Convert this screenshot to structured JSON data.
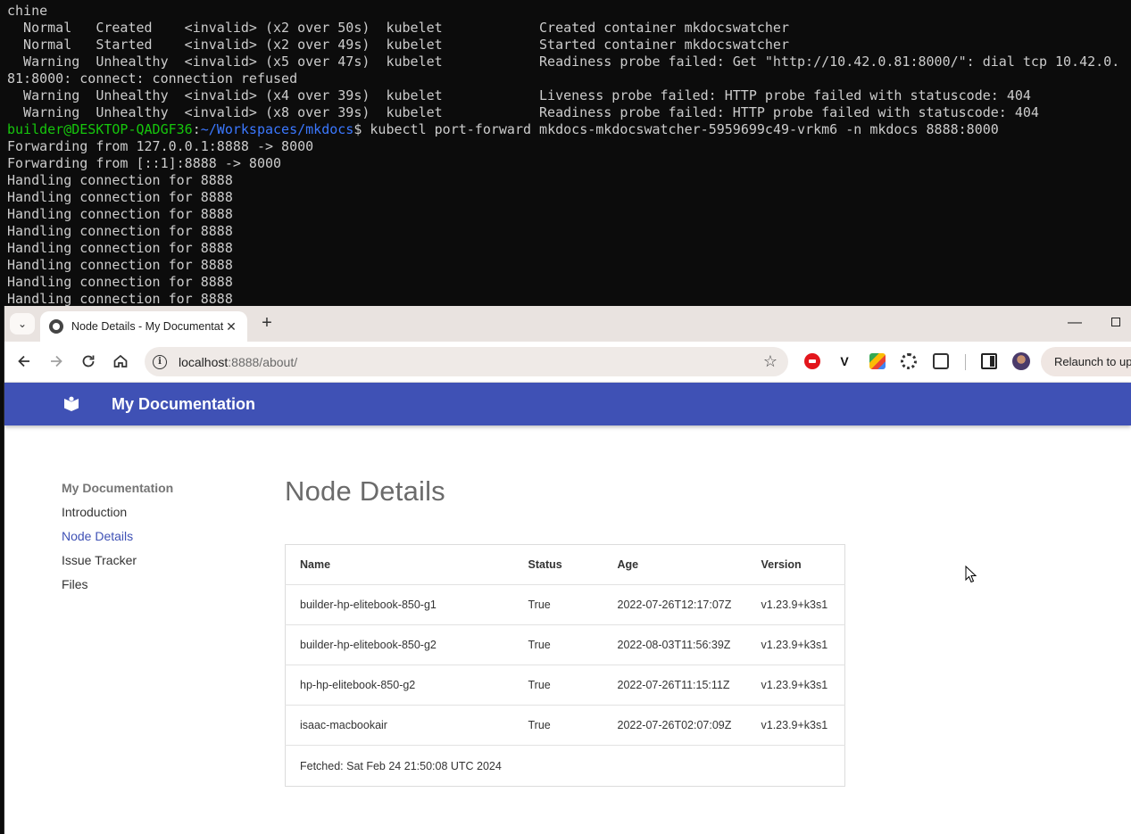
{
  "terminal": {
    "lines": [
      "chine",
      "  Normal   Created    <invalid> (x2 over 50s)  kubelet            Created container mkdocswatcher",
      "  Normal   Started    <invalid> (x2 over 49s)  kubelet            Started container mkdocswatcher",
      "  Warning  Unhealthy  <invalid> (x5 over 47s)  kubelet            Readiness probe failed: Get \"http://10.42.0.81:8000/\": dial tcp 10.42.0.",
      "81:8000: connect: connection refused",
      "  Warning  Unhealthy  <invalid> (x4 over 39s)  kubelet            Liveness probe failed: HTTP probe failed with statuscode: 404",
      "  Warning  Unhealthy  <invalid> (x8 over 39s)  kubelet            Readiness probe failed: HTTP probe failed with statuscode: 404"
    ],
    "prompt_user": "builder@DESKTOP-QADGF36",
    "prompt_sep": ":",
    "prompt_path": "~/Workspaces/mkdocs",
    "prompt_cmd": "$ kubectl port-forward mkdocs-mkdocswatcher-5959699c49-vrkm6 -n mkdocs 8888:8000",
    "output": [
      "Forwarding from 127.0.0.1:8888 -> 8000",
      "Forwarding from [::1]:8888 -> 8000",
      "Handling connection for 8888",
      "Handling connection for 8888",
      "Handling connection for 8888",
      "Handling connection for 8888",
      "Handling connection for 8888",
      "Handling connection for 8888",
      "Handling connection for 8888",
      "Handling connection for 8888"
    ],
    "colors": {
      "user": "#16c60c",
      "path": "#3b78ff",
      "text": "#cccccc",
      "bg": "#0c0c0c"
    }
  },
  "browser": {
    "tab_title": "Node Details - My Documentation",
    "tab_close": "✕",
    "new_tab": "+",
    "url_host": "localhost",
    "url_rest": ":8888/about/",
    "relaunch": "Relaunch to update",
    "icons": [
      "tab-search-icon",
      "back-arrow-icon",
      "forward-arrow-icon",
      "reload-icon",
      "home-icon",
      "site-info-icon",
      "star-icon",
      "extension-icons",
      "side-panel-icon",
      "profile-avatar"
    ]
  },
  "site": {
    "title": "My Documentation",
    "header_color": "#3f51b5",
    "nav": {
      "title": "My Documentation",
      "items": [
        {
          "label": "Introduction",
          "active": false
        },
        {
          "label": "Node Details",
          "active": true
        },
        {
          "label": "Issue Tracker",
          "active": false
        },
        {
          "label": "Files",
          "active": false
        }
      ]
    },
    "page_title": "Node Details",
    "table": {
      "headers": [
        "Name",
        "Status",
        "Age",
        "Version"
      ],
      "rows": [
        [
          "builder-hp-elitebook-850-g1",
          "True",
          "2022-07-26T12:17:07Z",
          "v1.23.9+k3s1"
        ],
        [
          "builder-hp-elitebook-850-g2",
          "True",
          "2022-08-03T11:56:39Z",
          "v1.23.9+k3s1"
        ],
        [
          "hp-hp-elitebook-850-g2",
          "True",
          "2022-07-26T11:15:11Z",
          "v1.23.9+k3s1"
        ],
        [
          "isaac-macbookair",
          "True",
          "2022-07-26T02:07:09Z",
          "v1.23.9+k3s1"
        ]
      ],
      "footer": "Fetched: Sat Feb 24 21:50:08 UTC 2024"
    }
  }
}
